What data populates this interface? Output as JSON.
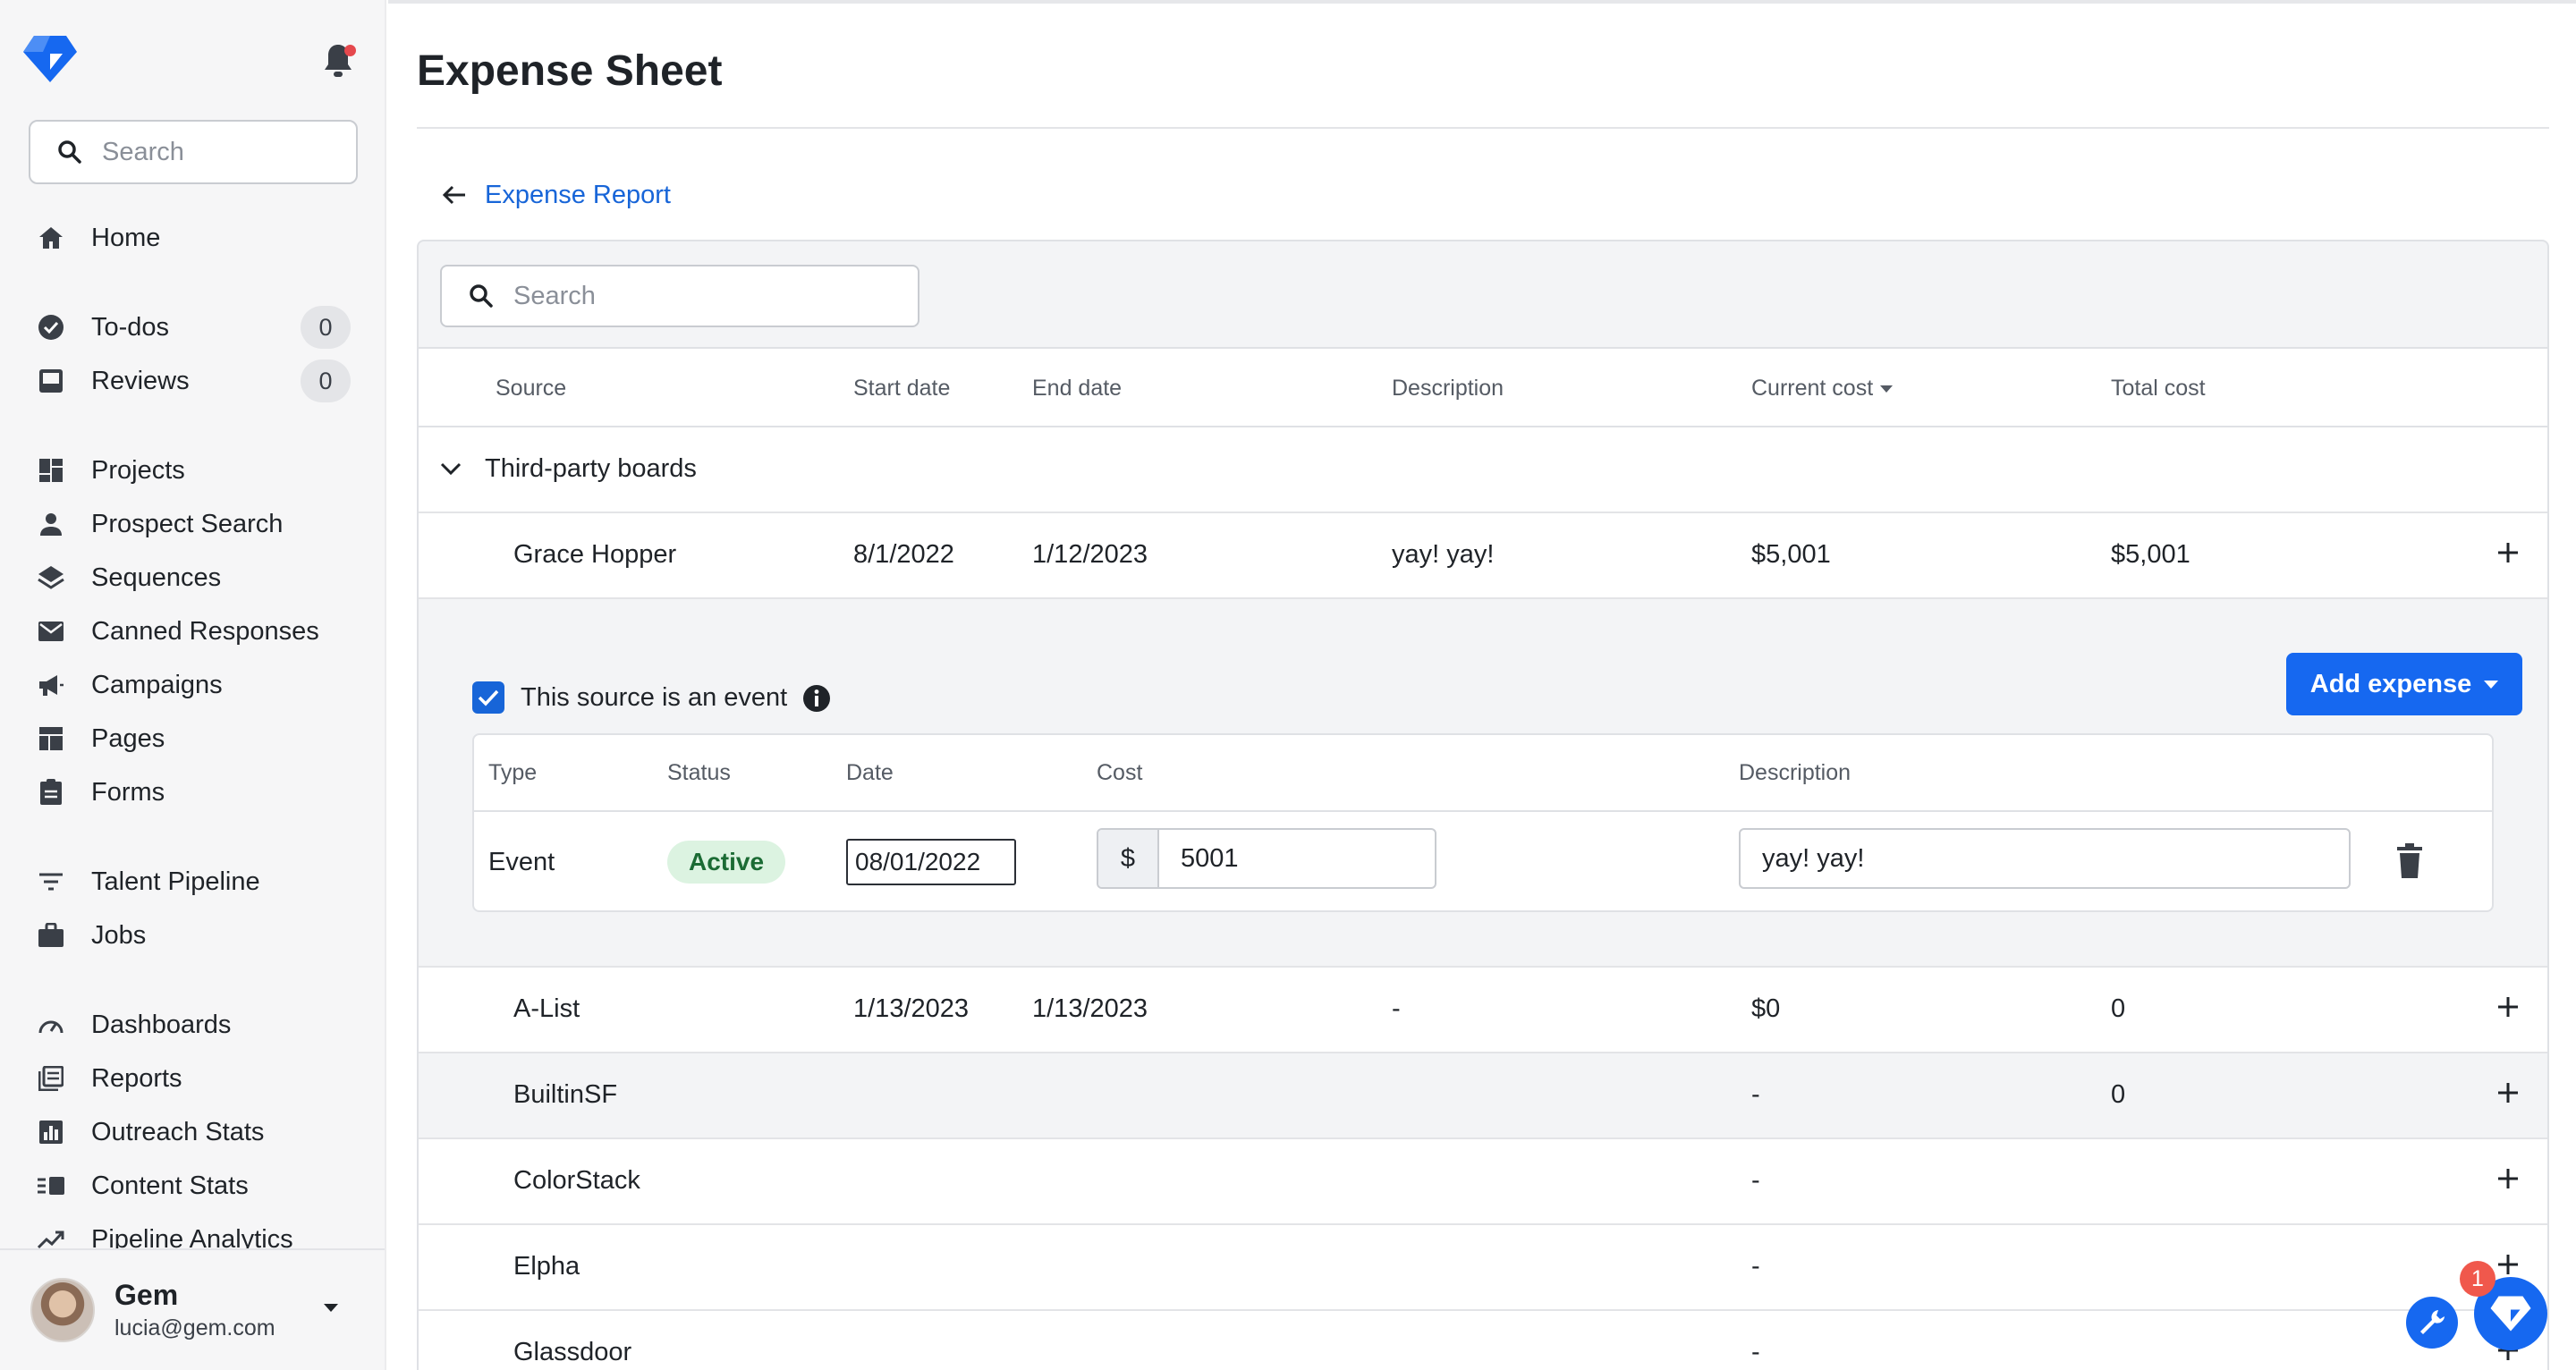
{
  "sidebar": {
    "search_placeholder": "Search",
    "items": [
      {
        "label": "Home"
      },
      {
        "label": "To-dos",
        "count": "0"
      },
      {
        "label": "Reviews",
        "count": "0"
      },
      {
        "label": "Projects"
      },
      {
        "label": "Prospect Search"
      },
      {
        "label": "Sequences"
      },
      {
        "label": "Canned Responses"
      },
      {
        "label": "Campaigns"
      },
      {
        "label": "Pages"
      },
      {
        "label": "Forms"
      },
      {
        "label": "Talent Pipeline"
      },
      {
        "label": "Jobs"
      },
      {
        "label": "Dashboards"
      },
      {
        "label": "Reports"
      },
      {
        "label": "Outreach Stats"
      },
      {
        "label": "Content Stats"
      },
      {
        "label": "Pipeline Analytics"
      }
    ],
    "user": {
      "name": "Gem",
      "email": "lucia@gem.com"
    }
  },
  "page": {
    "title": "Expense Sheet",
    "back_label": "Expense Report",
    "search_placeholder": "Search"
  },
  "table": {
    "headers": {
      "source": "Source",
      "start": "Start date",
      "end": "End date",
      "description": "Description",
      "current_cost": "Current cost",
      "total_cost": "Total cost"
    },
    "group": "Third-party boards",
    "rows": [
      {
        "source": "Grace Hopper",
        "start": "8/1/2022",
        "end": "1/12/2023",
        "description": "yay! yay!",
        "current": "$5,001",
        "total": "$5,001"
      },
      {
        "source": "A-List",
        "start": "1/13/2023",
        "end": "1/13/2023",
        "description": "-",
        "current": "$0",
        "total": "0"
      },
      {
        "source": "BuiltinSF",
        "start": "",
        "end": "",
        "description": "",
        "current": "-",
        "total": "0"
      },
      {
        "source": "ColorStack",
        "start": "",
        "end": "",
        "description": "",
        "current": "-",
        "total": ""
      },
      {
        "source": "Elpha",
        "start": "",
        "end": "",
        "description": "",
        "current": "-",
        "total": ""
      },
      {
        "source": "Glassdoor",
        "start": "",
        "end": "",
        "description": "",
        "current": "-",
        "total": ""
      }
    ]
  },
  "detail": {
    "event_checkbox_label": "This source is an event",
    "add_expense_label": "Add expense",
    "headers": {
      "type": "Type",
      "status": "Status",
      "date": "Date",
      "cost": "Cost",
      "description": "Description"
    },
    "expense": {
      "type": "Event",
      "status": "Active",
      "date": "08/01/2022",
      "currency": "$",
      "cost": "5001",
      "description": "yay! yay!"
    }
  },
  "fab": {
    "badge_count": "1"
  },
  "colors": {
    "accent": "#1668f0",
    "link": "#1765d8",
    "active_badge_bg": "#dcf3e1",
    "notification": "#e5484d"
  }
}
